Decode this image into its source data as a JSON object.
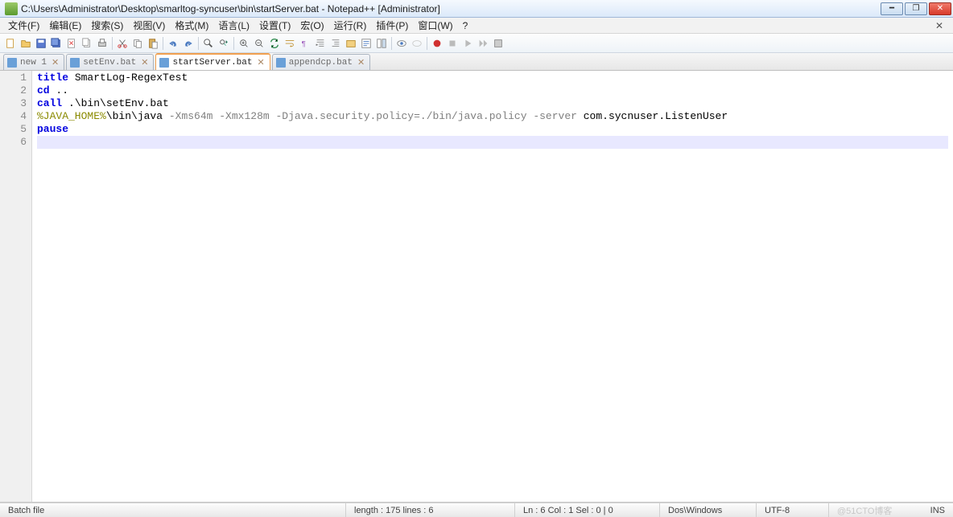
{
  "window": {
    "title": "C:\\Users\\Administrator\\Desktop\\smarltog-syncuser\\bin\\startServer.bat - Notepad++ [Administrator]"
  },
  "menu": {
    "file": "文件(F)",
    "edit": "编辑(E)",
    "search": "搜索(S)",
    "view": "视图(V)",
    "format": "格式(M)",
    "language": "语言(L)",
    "settings": "设置(T)",
    "macro": "宏(O)",
    "run": "运行(R)",
    "plugins": "插件(P)",
    "window": "窗口(W)",
    "help": "?"
  },
  "toolbar_icons": [
    "new",
    "open",
    "save",
    "save-all",
    "close",
    "close-all",
    "print",
    "cut",
    "copy",
    "paste",
    "undo",
    "redo",
    "find",
    "replace",
    "zoom-in",
    "zoom-out",
    "sync",
    "wrap",
    "invisible",
    "indent",
    "language",
    "folder",
    "func",
    "comment",
    "uncomment",
    "bookmark",
    "rec",
    "play",
    "play-multi",
    "stop",
    "macro-save"
  ],
  "tabs": [
    {
      "label": "new 1",
      "active": false,
      "close": "✕"
    },
    {
      "label": "setEnv.bat",
      "active": false,
      "close": "✕"
    },
    {
      "label": "startServer.bat",
      "active": true,
      "close": "✕"
    },
    {
      "label": "appendcp.bat",
      "active": false,
      "close": "✕"
    }
  ],
  "code": {
    "line1": {
      "kw": "title",
      "rest": " SmartLog-RegexTest"
    },
    "line2": {
      "kw": "cd",
      "rest": " .."
    },
    "line3": {
      "kw": "call",
      "rest": " .\\bin\\setEnv.bat"
    },
    "line4": {
      "var": "%JAVA_HOME%",
      "mid": "\\bin\\java",
      "args": " -Xms64m -Xmx128m -Djava.security.policy=./bin/java.policy -server ",
      "end": "com.sycnuser.ListenUser"
    },
    "line5": {
      "kw": "pause"
    }
  },
  "lineNumbers": [
    "1",
    "2",
    "3",
    "4",
    "5",
    "6"
  ],
  "status": {
    "filetype": "Batch file",
    "length": "length : 175    lines : 6",
    "pos": "Ln : 6    Col : 1    Sel : 0 | 0",
    "encoding": "Dos\\Windows",
    "utf": "UTF-8",
    "watermark": "@51CTO博客",
    "ins": "INS"
  }
}
